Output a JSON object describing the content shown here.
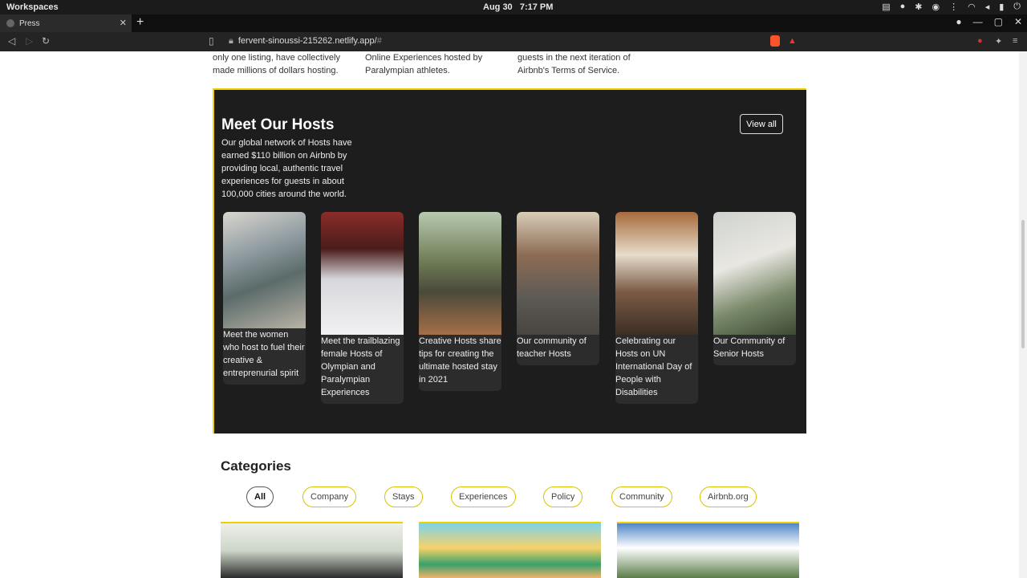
{
  "os": {
    "workspace": "Workspaces",
    "date": "Aug 30",
    "time": "7:17 PM"
  },
  "browser": {
    "tab_title": "Press",
    "url": "fervent-sinoussi-215262.netlify.app/",
    "url_hash": "#"
  },
  "stats": [
    {
      "lines": [
        "only one listing, have collectively",
        "made millions of dollars hosting."
      ]
    },
    {
      "lines": [
        "Online Experiences hosted by",
        "Paralympian athletes."
      ]
    },
    {
      "lines": [
        "guests in the next iteration of",
        "Airbnb's Terms of Service."
      ]
    }
  ],
  "hosts": {
    "title": "Meet Our Hosts",
    "description": "Our global network of Hosts have earned $110 billion on Airbnb by providing local, authentic travel experiences for guests in about 100,000 cities around the world.",
    "view_all": "View all",
    "cards": [
      {
        "caption": "Meet the women who host to fuel their creative & entreprenurial spirit"
      },
      {
        "caption": "Meet the trailblazing female Hosts of Olympian and Paralympian Experiences"
      },
      {
        "caption": "Creative Hosts share tips for creating the ultimate hosted stay in 2021"
      },
      {
        "caption": "Our community of teacher Hosts"
      },
      {
        "caption": "Celebrating our Hosts on UN International Day of People with Disabilities"
      },
      {
        "caption": "Our Community of Senior Hosts"
      }
    ]
  },
  "categories": {
    "title_first": "C",
    "title_rest": "ategories",
    "chips": [
      "All",
      "Company",
      "Stays",
      "Experiences",
      "Policy",
      "Community",
      "Airbnb.org"
    ],
    "active": "All"
  }
}
